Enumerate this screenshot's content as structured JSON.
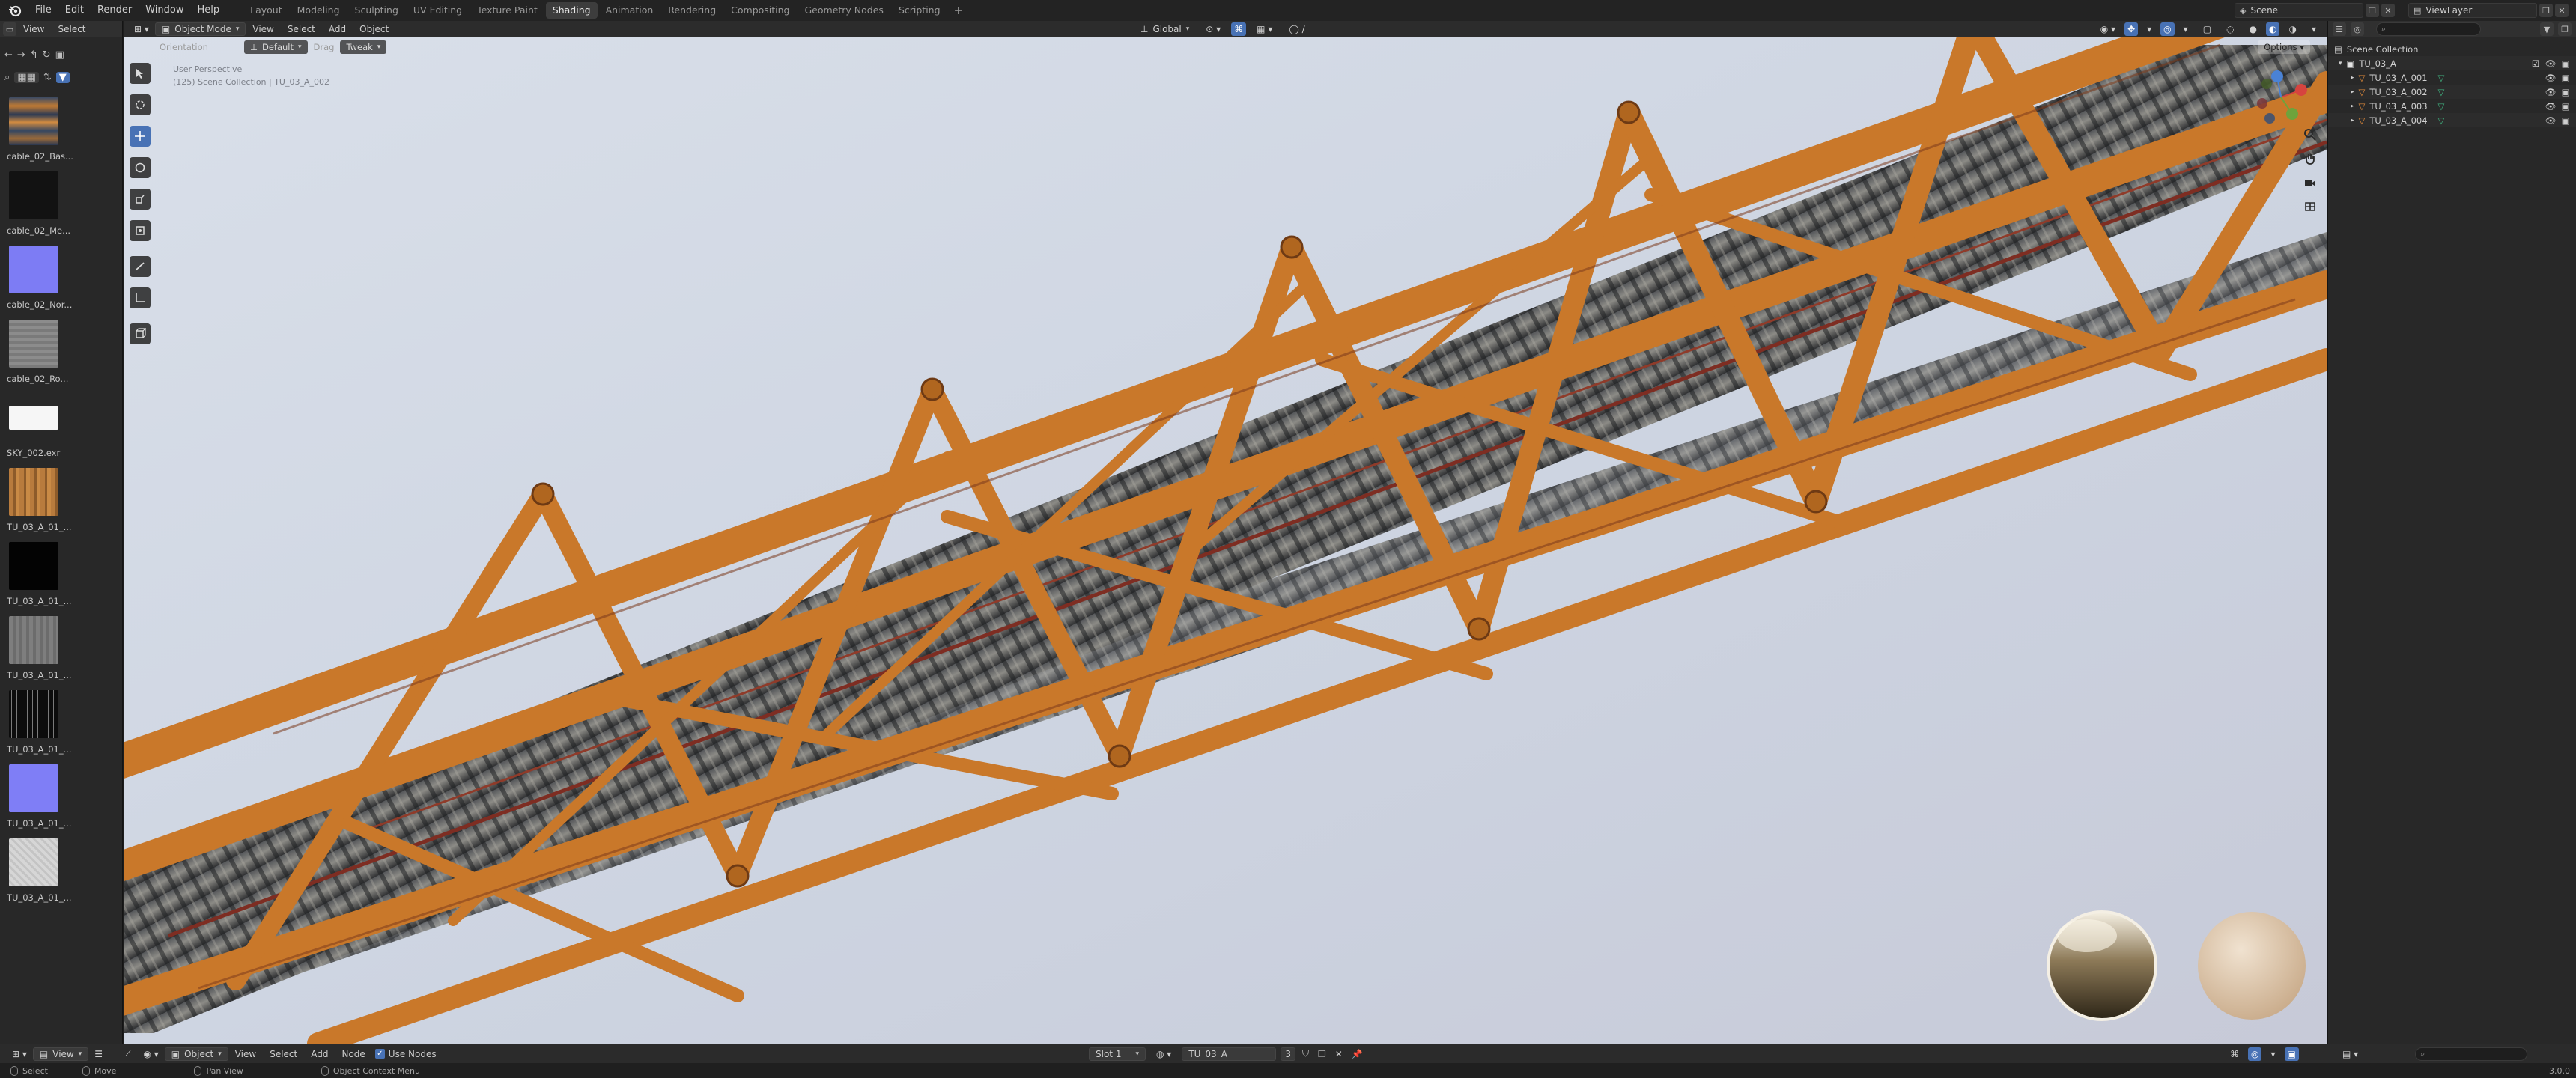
{
  "topbar": {
    "menus": [
      "File",
      "Edit",
      "Render",
      "Window",
      "Help"
    ],
    "workspaces": [
      "Layout",
      "Modeling",
      "Sculpting",
      "UV Editing",
      "Texture Paint",
      "Shading",
      "Animation",
      "Rendering",
      "Compositing",
      "Geometry Nodes",
      "Scripting"
    ],
    "active_workspace": "Shading",
    "add_tab": "+",
    "scene_label": "Scene",
    "viewlayer_label": "ViewLayer"
  },
  "image_browser": {
    "header_menus": [
      "View",
      "Select"
    ],
    "items": [
      {
        "label": "cable_02_Bas...",
        "color": "#6b5a45"
      },
      {
        "label": "cable_02_Me...",
        "color": "#141414"
      },
      {
        "label": "cable_02_Nor...",
        "color": "#7d7cf4"
      },
      {
        "label": "cable_02_Ro...",
        "color": "#8a8a8a"
      },
      {
        "label": "SKY_002.exr",
        "color": "#f4f4f4"
      },
      {
        "label": "TU_03_A_01_...",
        "color": "#b47a3c"
      },
      {
        "label": "TU_03_A_01_...",
        "color": "#050505"
      },
      {
        "label": "TU_03_A_01_...",
        "color": "#7c7c7c"
      },
      {
        "label": "TU_03_A_01_...",
        "color": "#1c1c1c"
      },
      {
        "label": "TU_03_A_01_...",
        "color": "#7f7ef6"
      },
      {
        "label": "TU_03_A_01_...",
        "color": "#d2d2d2"
      }
    ]
  },
  "viewport": {
    "mode": "Object Mode",
    "menus": [
      "View",
      "Select",
      "Add",
      "Object"
    ],
    "transform_orientation": "Global",
    "orientation_label": "Orientation",
    "orientation_value": "Default",
    "drag_label": "Drag",
    "drag_value": "Tweak",
    "options_label": "Options",
    "info_line1": "User Perspective",
    "info_line2": "(125) Scene Collection | TU_03_A_002"
  },
  "outliner": {
    "root": "Scene Collection",
    "collection": "TU_03_A",
    "objects": [
      "TU_03_A_001",
      "TU_03_A_002",
      "TU_03_A_003",
      "TU_03_A_004"
    ]
  },
  "node_editor": {
    "editor_menu": "View",
    "object_type": "Object",
    "menus": [
      "View",
      "Select",
      "Add",
      "Node"
    ],
    "use_nodes_label": "Use Nodes",
    "slot": "Slot 1",
    "material": "TU_03_A",
    "user_count": "3"
  },
  "statusbar": {
    "items": [
      "Select",
      "Move",
      "Pan View",
      "Object Context Menu"
    ],
    "version": "3.0.0"
  },
  "colors": {
    "accent": "#4872b5",
    "truss": "#c9782a",
    "sky": "#d3dae4",
    "mesh_icon": "#e08a3a",
    "data_icon": "#3fb27f"
  }
}
